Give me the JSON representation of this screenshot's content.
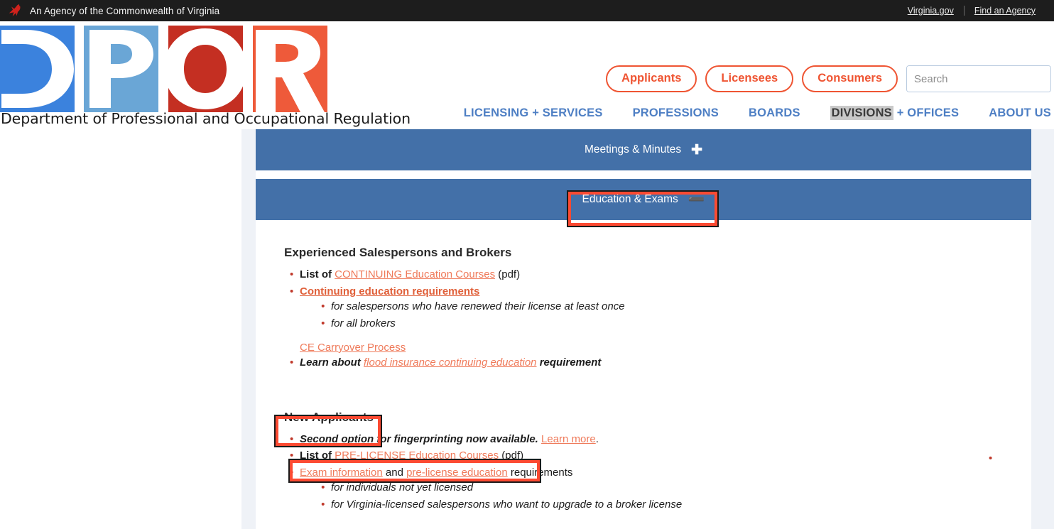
{
  "gov_bar": {
    "bird_icon": "cardinal-bird-icon",
    "agency_text": "An Agency of the Commonwealth of Virginia",
    "link_virginia": "Virginia.gov",
    "link_find_agency": "Find an Agency"
  },
  "brand": {
    "logo_letters": "DPOR",
    "logo_colors": [
      "#3b82dd",
      "#6aa6d6",
      "#c42f22",
      "#ee5a3a"
    ],
    "tagline": "Department of Professional and Occupational Regulation"
  },
  "header": {
    "pills": [
      {
        "label": "Applicants"
      },
      {
        "label": "Licensees"
      },
      {
        "label": "Consumers"
      }
    ],
    "search": {
      "placeholder": "Search",
      "value": "",
      "button_icon": "search-icon"
    },
    "accent_orange": "#ef5533",
    "accent_blue": "#4e7fc4"
  },
  "mainnav": {
    "items": [
      {
        "label": "LICENSING + SERVICES",
        "highlighted": false
      },
      {
        "label": "PROFESSIONS",
        "highlighted": false
      },
      {
        "label": "BOARDS",
        "highlighted": false
      },
      {
        "label": "DIVISIONS",
        "label_rest": " + OFFICES",
        "highlighted": true
      },
      {
        "label": "ABOUT US",
        "highlighted": false
      }
    ]
  },
  "accordions": [
    {
      "label": "Meetings & Minutes",
      "sign": "✚",
      "expanded": false
    },
    {
      "label": "Education & Exams",
      "sign": "➖",
      "expanded": true
    }
  ],
  "article": {
    "section1": {
      "heading": "Experienced Salespersons and Brokers",
      "item1_pre": "List of ",
      "item1_link": "CONTINUING Education Courses",
      "item1_post": " (pdf)",
      "item2_link": "Continuing education requirements",
      "item2_sub1": "for salespersons who have renewed their license at least once",
      "item2_sub2": "for all brokers",
      "carryover_link": "CE Carryover Process",
      "item3_pre": "Learn about ",
      "item3_link": "flood insurance continuing education",
      "item3_post": " requirement"
    },
    "section2": {
      "heading": "New Applicants",
      "item1_text": "Second option for fingerprinting now available.",
      "item1_link": "Learn more",
      "item1_post": ".",
      "item2_pre": "List of ",
      "item2_link": "PRE-LICENSE Education Courses",
      "item2_post": " (pdf)",
      "item3_link1": "Exam information",
      "item3_mid": " and ",
      "item3_link2": "pre-license education",
      "item3_post": " requirements",
      "item3_sub1": "for individuals not yet licensed",
      "item3_sub2": "for Virginia-licensed salespersons who want to upgrade to a broker license"
    }
  },
  "annotations": {
    "box_color": "#fc4a32",
    "boxes": [
      {
        "target": "Education & Exams"
      },
      {
        "target": "New Applicants"
      },
      {
        "target": "List of PRE-LICENSE Education Courses (pdf)"
      }
    ]
  }
}
